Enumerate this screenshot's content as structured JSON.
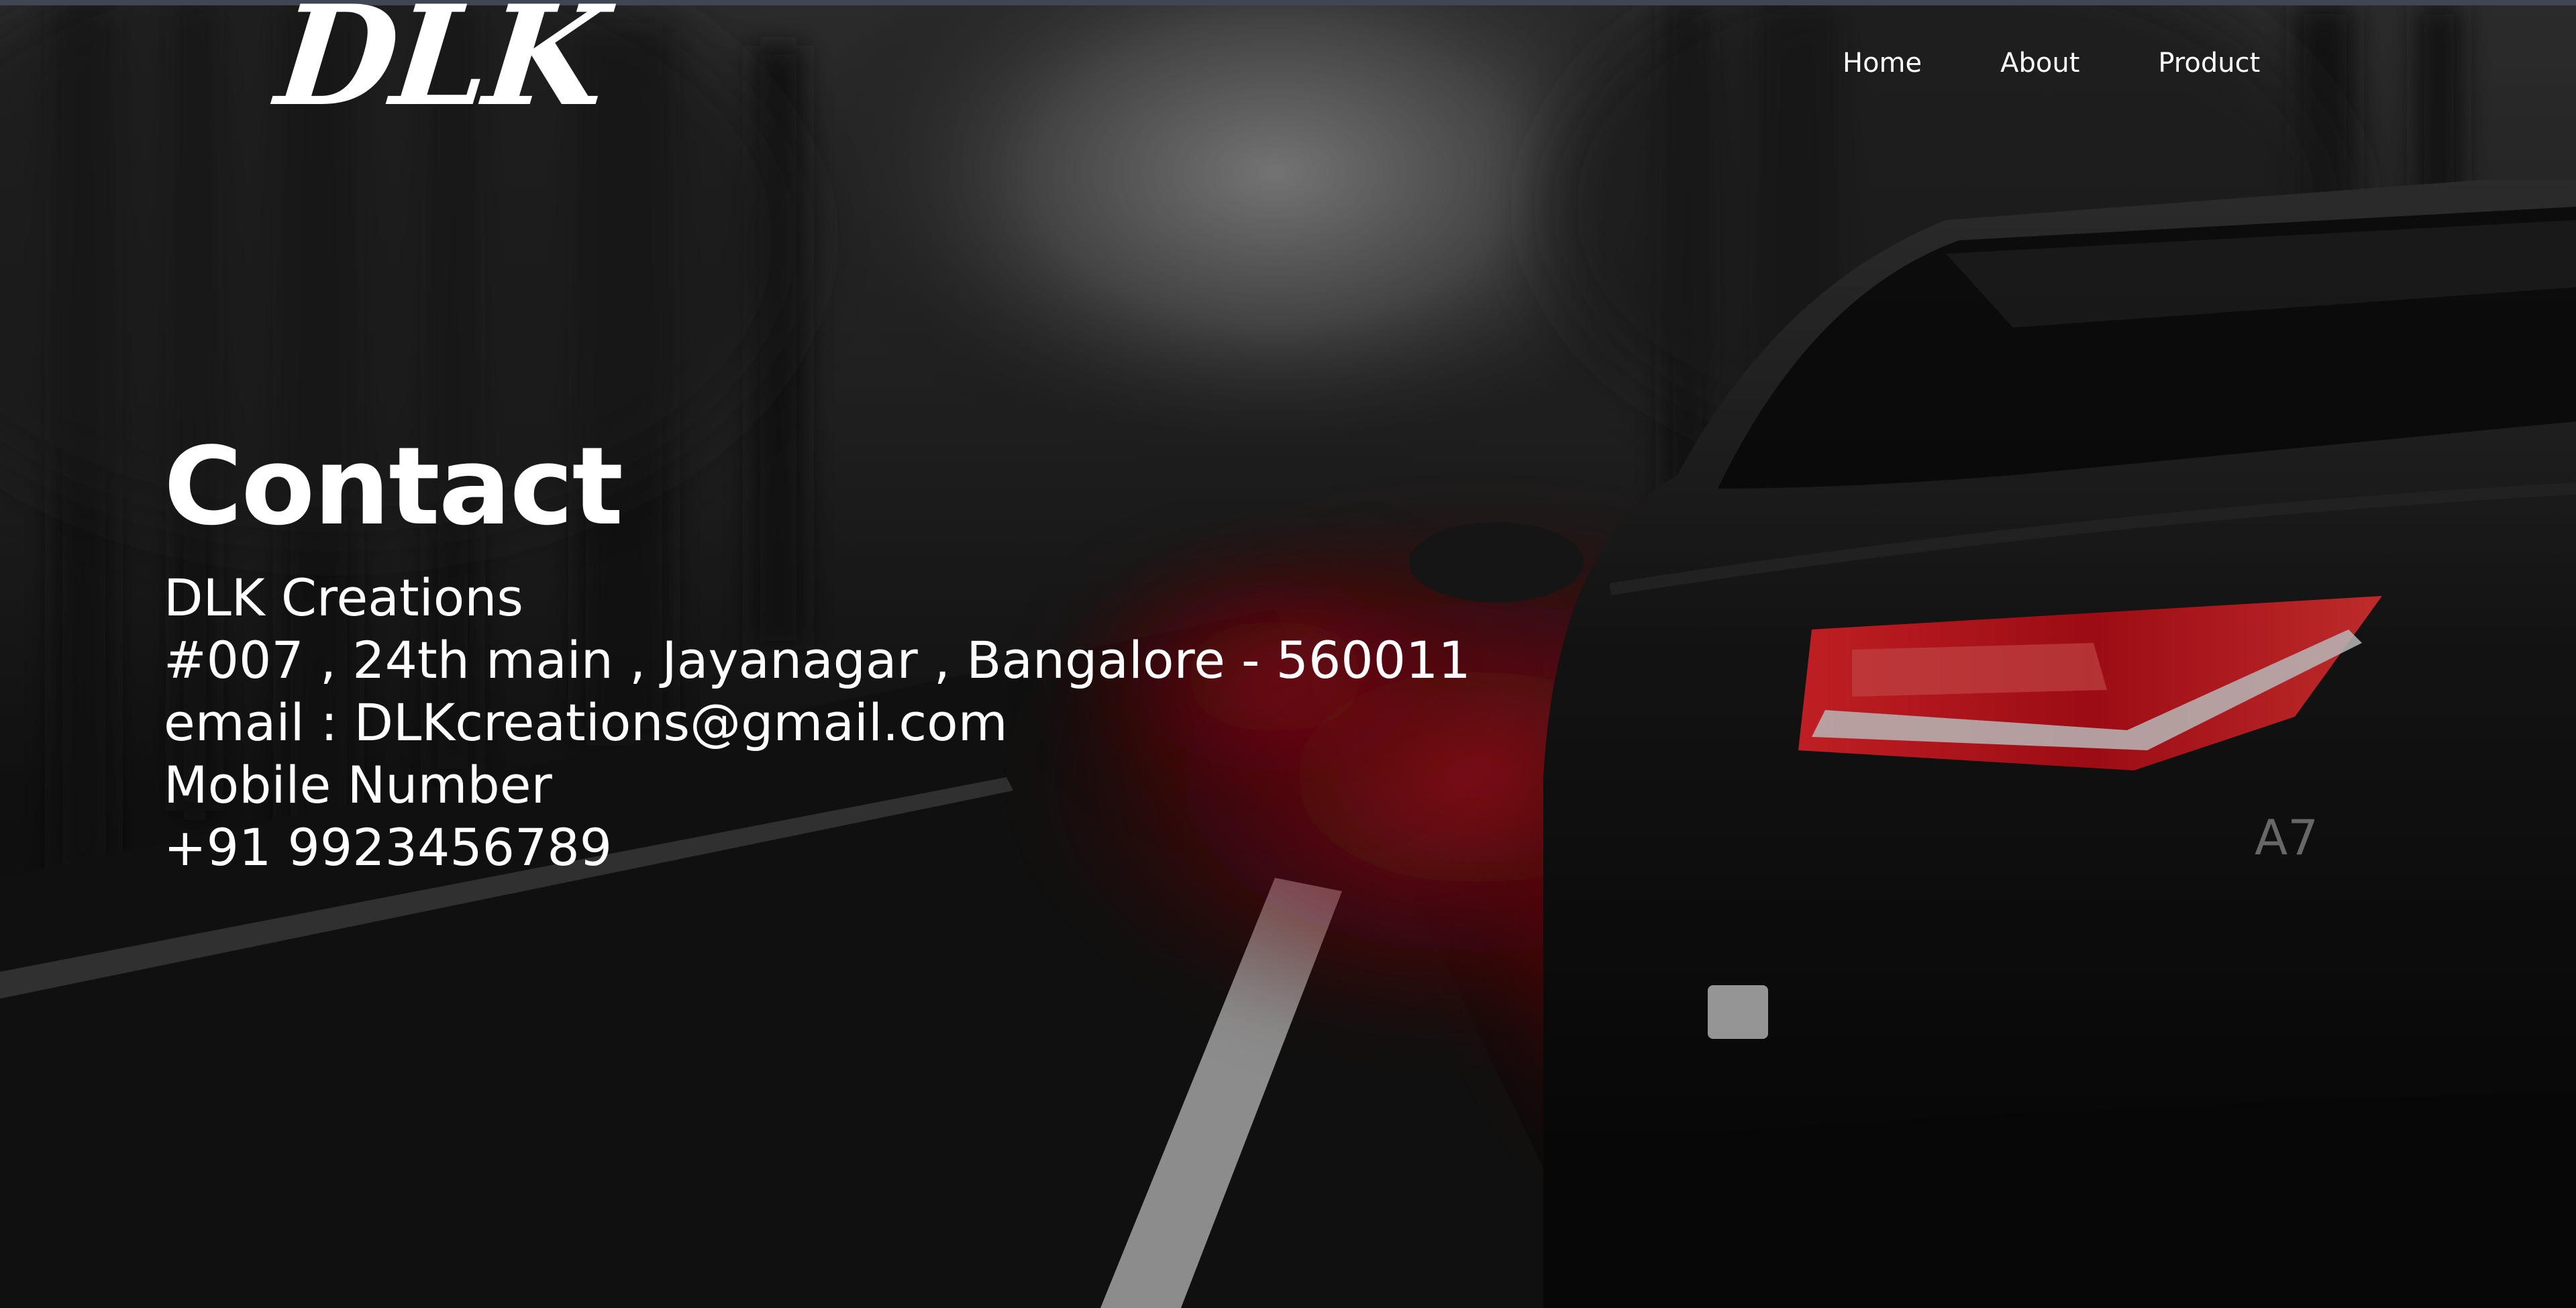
{
  "header": {
    "logo_text": "DLK",
    "nav": {
      "home": "Home",
      "about": "About",
      "product": "Product"
    }
  },
  "contact": {
    "title": "Contact",
    "company": "DLK Creations",
    "address": "#007 , 24th main , Jayanagar , Bangalore - 560011",
    "email": "email : DLKcreations@gmail.com",
    "mobile_label": "Mobile Number",
    "mobile_number": "+91 9923456789"
  },
  "colors": {
    "text": "#ffffff",
    "top_strip": "#3f4654",
    "taillight_red": "#c0101a"
  },
  "background": {
    "subject": "dark car rear with red taillights and red smoke on a forest road",
    "badge_text": "A7"
  }
}
